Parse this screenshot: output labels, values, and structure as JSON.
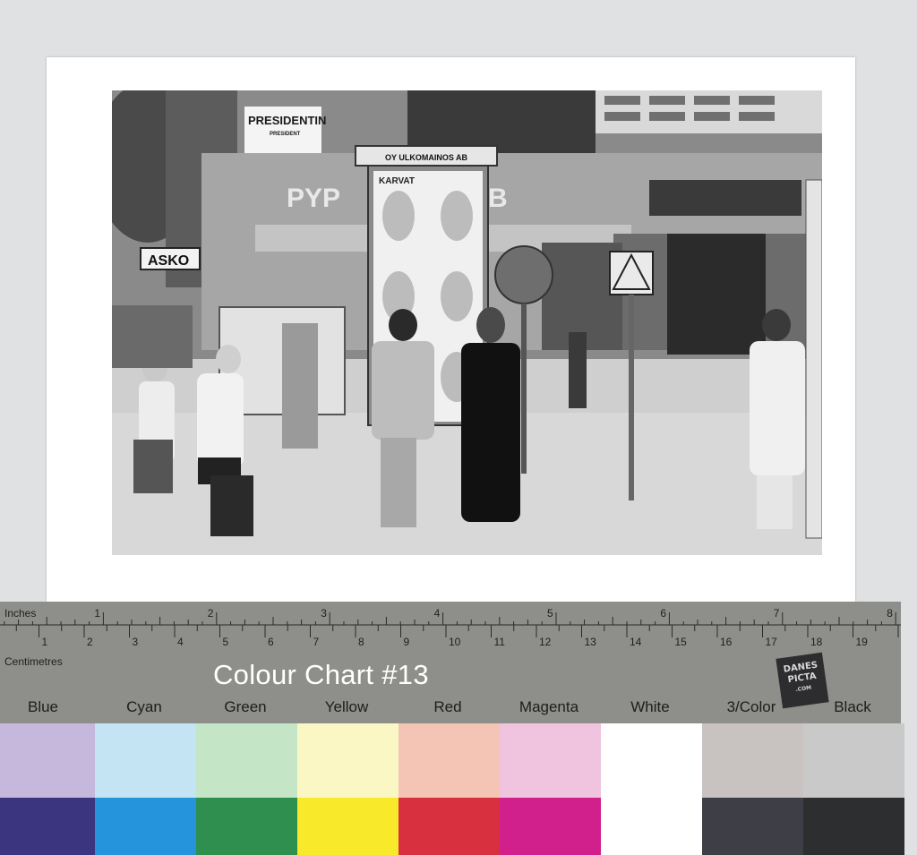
{
  "photo": {
    "signs": {
      "presidentin": "PRESIDENTIN",
      "president": "PRESIDENT",
      "asko": "ASKO",
      "kiosk_company": "OY ULKOMAINOS AB",
      "facade_letters": "PYP",
      "facade_letter_b": "B",
      "poster_brand": "KARVAT"
    }
  },
  "ruler": {
    "inches_label": "Inches",
    "centimetres_label": "Centimetres",
    "inch_numbers": [
      "1",
      "2",
      "3",
      "4",
      "5",
      "6",
      "7",
      "8"
    ],
    "cm_numbers": [
      "1",
      "2",
      "3",
      "4",
      "5",
      "6",
      "7",
      "8",
      "9",
      "10",
      "11",
      "12",
      "13",
      "14",
      "15",
      "16",
      "17",
      "18",
      "19"
    ]
  },
  "colour_chart": {
    "title": "Colour Chart #13",
    "logo_line1": "DANES",
    "logo_line2": "PICTA",
    "logo_line3": ".COM",
    "swatches": [
      {
        "label": "Blue",
        "top": "#c6b8dd",
        "bottom": "#3b3580"
      },
      {
        "label": "Cyan",
        "top": "#c4e4f4",
        "bottom": "#2594dc"
      },
      {
        "label": "Green",
        "top": "#c4e6c7",
        "bottom": "#2f8f4f"
      },
      {
        "label": "Yellow",
        "top": "#fbf7c4",
        "bottom": "#f8ea2a"
      },
      {
        "label": "Red",
        "top": "#f4c4b4",
        "bottom": "#d9303f"
      },
      {
        "label": "Magenta",
        "top": "#f0c4de",
        "bottom": "#d1208b"
      },
      {
        "label": "White",
        "top": "#ffffff",
        "bottom": "#ffffff"
      },
      {
        "label": "3/Color",
        "top": "#c8c2c0",
        "bottom": "#3e3e46"
      },
      {
        "label": "Black",
        "top": "#c9c9c9",
        "bottom": "#2d2e30"
      }
    ]
  }
}
